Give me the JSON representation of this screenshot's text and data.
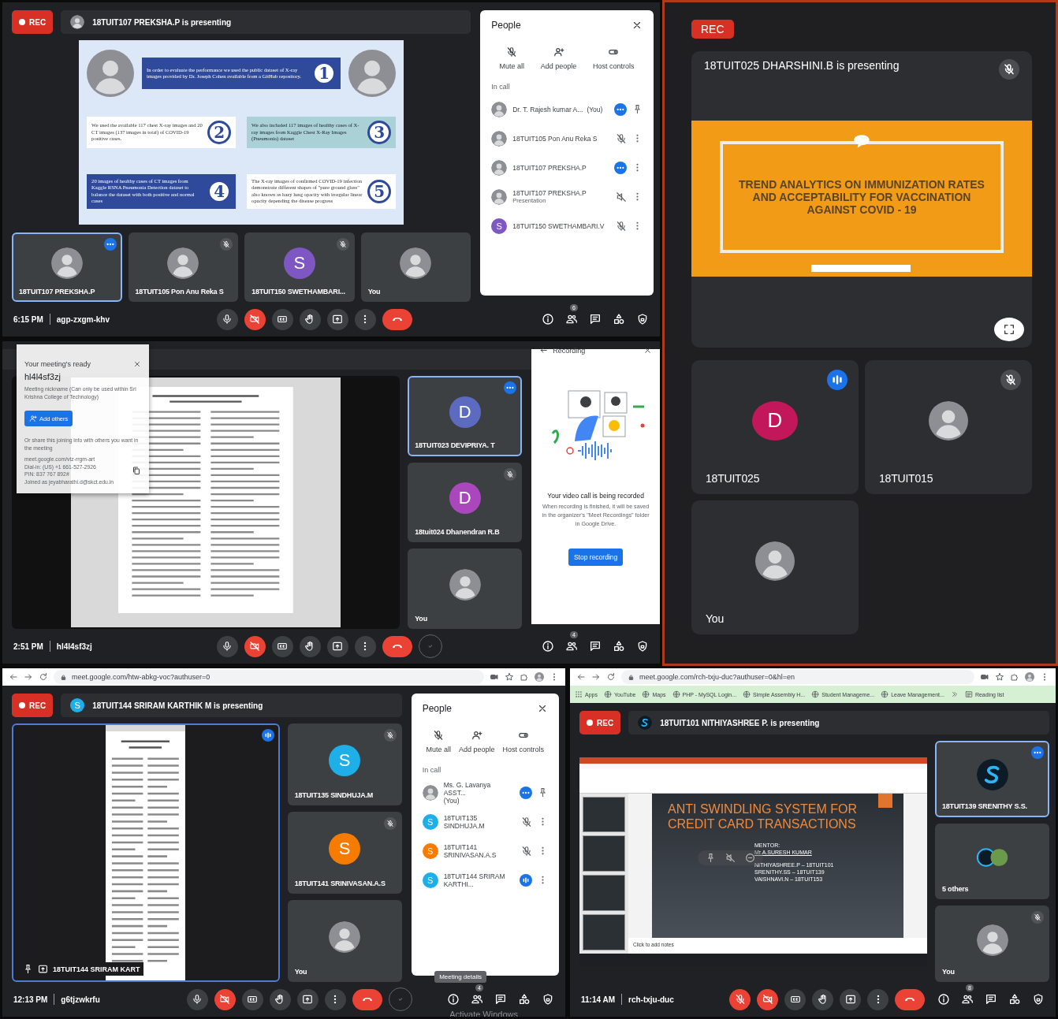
{
  "panels": [
    {
      "kind": "desktop",
      "rec": "REC",
      "presenting": {
        "text": "18TUIT107 PREKSHA.P is presenting",
        "avatar": {
          "kind": "photo"
        }
      },
      "stage": {
        "kind": "infographic",
        "items": [
          {
            "number": "1",
            "text": "In order to evaluate the performance we used the public dataset of X-ray images provided by Dr. Joseph Cohen available from a GitHub repository."
          },
          {
            "number": "2",
            "text": "We used the available 117 chest X-ray images and 20 CT images (137 images in total) of COVID-19 positive cases."
          },
          {
            "number": "3",
            "text": "We also included 117 images of healthy cases of X-ray images from Kaggle Chest X-Ray Images (Pneumonia) dataset"
          },
          {
            "number": "4",
            "text": "20 images of healthy cases of CT images from Kaggle RSNA Pneumonia Detection dataset to balance the dataset with both positive and normal cases"
          },
          {
            "number": "5",
            "text": "The X-ray images of confirmed COVID-19 infection demonstrate different shapes of \"pure ground glass\" also known as hazy lung opacity with irregular linear opacity depending the disease progress"
          }
        ]
      },
      "tile_strip": {
        "kind": "row",
        "tiles": [
          {
            "name": "18TUIT107 PREKSHA.P",
            "avatar": {
              "kind": "photo"
            },
            "badge": {
              "kind": "more"
            },
            "selected": true
          },
          {
            "name": "18TUIT105 Pon Anu Reka S",
            "avatar": {
              "kind": "photo"
            },
            "badge": {
              "kind": "muted"
            },
            "selected": false
          },
          {
            "name": "18TUIT150 SWETHAMBARI...",
            "avatar": {
              "kind": "letter",
              "letter": "S",
              "color": "#7e57c2"
            },
            "badge": {
              "kind": "muted"
            },
            "selected": false
          },
          {
            "name": "You",
            "avatar": {
              "kind": "photo"
            },
            "selected": false
          }
        ]
      },
      "side_panel": {
        "kind": "people",
        "title": "People",
        "actions": [
          {
            "kind": "mute",
            "label": "Mute all"
          },
          {
            "kind": "add",
            "label": "Add people"
          },
          {
            "kind": "host",
            "label": "Host controls"
          }
        ],
        "section": "In call",
        "people": [
          {
            "name": "Dr. T. Rajesh kumar A...",
            "you": "(You)",
            "avatar": {
              "kind": "photo"
            },
            "status": {
              "kind": "more"
            },
            "action": {
              "kind": "pin"
            }
          },
          {
            "name": "18TUIT105 Pon Anu Reka S",
            "avatar": {
              "kind": "photo"
            },
            "status": {
              "kind": "muted"
            },
            "action": {
              "kind": "menu"
            }
          },
          {
            "name": "18TUIT107 PREKSHA.P",
            "avatar": {
              "kind": "photo"
            },
            "status": {
              "kind": "more"
            },
            "action": {
              "kind": "menu"
            }
          },
          {
            "name": "18TUIT107 PREKSHA.P",
            "sub": "Presentation",
            "avatar": {
              "kind": "photo"
            },
            "status": {
              "kind": "volume_off"
            },
            "action": {
              "kind": "menu"
            }
          },
          {
            "name": "18TUIT150 SWETHAMBARI.V",
            "avatar": {
              "kind": "letter",
              "letter": "S",
              "color": "#7e57c2"
            },
            "status": {
              "kind": "muted"
            },
            "action": {
              "kind": "menu"
            }
          }
        ]
      },
      "footer": {
        "time": "6:15 PM",
        "code": "agp-zxgm-khv",
        "controls": [
          {
            "kind": "mic",
            "off": false
          },
          {
            "kind": "camera",
            "off": true
          },
          {
            "kind": "captions",
            "off": false
          },
          {
            "kind": "hand",
            "off": false
          },
          {
            "kind": "present",
            "off": false
          },
          {
            "kind": "more",
            "off": false
          },
          {
            "kind": "end",
            "off": false
          }
        ],
        "right": [
          {
            "kind": "info"
          },
          {
            "kind": "people",
            "count": "6"
          },
          {
            "kind": "chat"
          },
          {
            "kind": "activities"
          },
          {
            "kind": "safety"
          }
        ]
      }
    },
    {
      "kind": "mobile",
      "rec": "REC",
      "presenting": {
        "text": "18TUIT025 DHARSHINI.B is presenting",
        "badge": {
          "kind": "muted"
        }
      },
      "stage": {
        "kind": "slide",
        "title": "TREND ANALYTICS ON IMMUNIZATION RATES AND ACCEPTABILITY FOR VACCINATION AGAINST COVID - 19"
      },
      "tile_strip": {
        "kind": "grid",
        "tiles": [
          {
            "name": "18TUIT025",
            "avatar": {
              "kind": "letter",
              "letter": "D",
              "color": "#c2185b"
            },
            "badge": {
              "kind": "speaking"
            },
            "selected": false
          },
          {
            "name": "18TUIT015",
            "avatar": {
              "kind": "photo"
            },
            "badge": {
              "kind": "muted"
            },
            "selected": false
          },
          {
            "name": "You",
            "avatar": {
              "kind": "photo"
            },
            "selected": false
          }
        ]
      }
    },
    {
      "kind": "desktop",
      "popup": {
        "title": "Your meeting's ready",
        "code": "hl4l4sf3zj",
        "nickname": "Meeting nickname (Can only be used within Sri Krishna College of Technology)",
        "button": "Add others",
        "share": "Or share this joining info with others you want in the meeting",
        "link": "meet.google.com/vtz-rrgm-art",
        "dial": "Dial-in: (US) +1 661-527-2926",
        "pin": "PIN: 837 767 892#",
        "joined": "Joined as jeyabharathi.d@skct.edu.in"
      },
      "stage": {
        "kind": "document",
        "selected": false
      },
      "tile_strip": {
        "kind": "column",
        "tiles": [
          {
            "name": "18TUIT023 DEVIPRIYA. T",
            "avatar": {
              "kind": "letter",
              "letter": "D",
              "color": "#5c6bc0"
            },
            "badge": {
              "kind": "more"
            },
            "selected": true
          },
          {
            "name": "18tuit024 Dhanendran R.B",
            "avatar": {
              "kind": "letter",
              "letter": "D",
              "color": "#ab47bc"
            },
            "badge": {
              "kind": "muted"
            },
            "selected": false
          },
          {
            "name": "You",
            "avatar": {
              "kind": "photo"
            },
            "selected": false
          }
        ]
      },
      "side_panel": {
        "kind": "recording",
        "title": "Recording",
        "heading": "Your video call is being recorded",
        "text": "When recording is finished, it will be saved in the organizer's \"Meet Recordings\" folder in Google Drive.",
        "button": "Stop recording"
      },
      "footer": {
        "time": "2:51 PM",
        "code": "hl4l4sf3zj",
        "controls": [
          {
            "kind": "mic",
            "off": false
          },
          {
            "kind": "camera",
            "off": true
          },
          {
            "kind": "captions",
            "off": false
          },
          {
            "kind": "hand",
            "off": false
          },
          {
            "kind": "present",
            "off": false
          },
          {
            "kind": "more",
            "off": false
          },
          {
            "kind": "end",
            "off": false
          },
          {
            "kind": "check",
            "off": false
          }
        ],
        "right": [
          {
            "kind": "info"
          },
          {
            "kind": "people",
            "count": "4"
          },
          {
            "kind": "chat"
          },
          {
            "kind": "activities"
          },
          {
            "kind": "safety"
          }
        ]
      }
    },
    {
      "kind": "desktop",
      "browser": {
        "url": "meet.google.com/htw-abkg-voc?authuser=0"
      },
      "rec": "REC",
      "presenting": {
        "text": "18TUIT144 SRIRAM KARTHIK M is presenting",
        "avatar": {
          "kind": "letter",
          "letter": "S",
          "color": "#1eaee8"
        }
      },
      "stage": {
        "kind": "document",
        "selected": true,
        "label": "18TUIT144 SRIRAM KART",
        "badge": {
          "kind": "speaking"
        }
      },
      "tile_strip": {
        "kind": "column",
        "tiles": [
          {
            "name": "18TUIT135 SINDHUJA.M",
            "avatar": {
              "kind": "letter",
              "letter": "S",
              "color": "#1eaee8"
            },
            "badge": {
              "kind": "muted"
            },
            "selected": false
          },
          {
            "name": "18TUIT141 SRINIVASAN.A.S",
            "avatar": {
              "kind": "letter",
              "letter": "S",
              "color": "#f57c00"
            },
            "badge": {
              "kind": "muted"
            },
            "selected": false
          },
          {
            "name": "You",
            "avatar": {
              "kind": "photo"
            },
            "selected": false
          }
        ]
      },
      "side_panel": {
        "kind": "people",
        "title": "People",
        "actions": [
          {
            "kind": "mute",
            "label": "Mute all"
          },
          {
            "kind": "add",
            "label": "Add people"
          },
          {
            "kind": "host",
            "label": "Host controls"
          }
        ],
        "section": "In call",
        "people": [
          {
            "name": "Ms. G. Lavanya ASST...",
            "you": "(You)",
            "avatar": {
              "kind": "photo"
            },
            "status": {
              "kind": "more"
            },
            "action": {
              "kind": "pin"
            }
          },
          {
            "name": "18TUIT135 SINDHUJA.M",
            "avatar": {
              "kind": "letter",
              "letter": "S",
              "color": "#1eaee8"
            },
            "status": {
              "kind": "muted"
            },
            "action": {
              "kind": "menu"
            }
          },
          {
            "name": "18TUIT141 SRINIVASAN.A.S",
            "avatar": {
              "kind": "letter",
              "letter": "S",
              "color": "#f57c00"
            },
            "status": {
              "kind": "muted"
            },
            "action": {
              "kind": "menu"
            }
          },
          {
            "name": "18TUIT144 SRIRAM KARTHI...",
            "avatar": {
              "kind": "letter",
              "letter": "S",
              "color": "#1eaee8"
            },
            "status": {
              "kind": "speaking"
            },
            "action": {
              "kind": "menu"
            }
          }
        ]
      },
      "footer": {
        "time": "12:13 PM",
        "code": "g6tjzwkrfu",
        "tooltip": "Meeting details",
        "os_notice": "Activate Windows",
        "controls": [
          {
            "kind": "mic",
            "off": false
          },
          {
            "kind": "camera",
            "off": true
          },
          {
            "kind": "captions",
            "off": false
          },
          {
            "kind": "hand",
            "off": false
          },
          {
            "kind": "present",
            "off": false
          },
          {
            "kind": "more",
            "off": false
          },
          {
            "kind": "end",
            "off": false
          },
          {
            "kind": "check",
            "off": false
          }
        ],
        "right": [
          {
            "kind": "info"
          },
          {
            "kind": "people",
            "count": "4"
          },
          {
            "kind": "chat"
          },
          {
            "kind": "activities"
          },
          {
            "kind": "safety"
          }
        ]
      }
    },
    {
      "kind": "desktop",
      "browser": {
        "url": "meet.google.com/rch-txju-duc?authuser=0&hl=en",
        "bookmarks": [
          {
            "kind": "apps",
            "label": "Apps"
          },
          {
            "kind": "link",
            "label": "YouTube"
          },
          {
            "kind": "link",
            "label": "Maps"
          },
          {
            "kind": "link",
            "label": "PHP - MySQL Login..."
          },
          {
            "kind": "link",
            "label": "Simple Assembly H..."
          },
          {
            "kind": "link",
            "label": "Student Manageme..."
          },
          {
            "kind": "link",
            "label": "Leave Management..."
          },
          {
            "kind": "reading",
            "label": "Reading list"
          }
        ]
      },
      "rec": "REC",
      "presenting": {
        "text": "18TUIT101 NITHIYASHREE P. is presenting",
        "avatar": {
          "kind": "logo"
        }
      },
      "stage": {
        "kind": "presentation",
        "title": "ANTI SWINDLING SYSTEM FOR CREDIT CARD TRANSACTIONS",
        "mentor": [
          "MENTOR:",
          "Mr.A.SURESH KUMAR"
        ],
        "team": [
          "NITHIYASHREE.P – 18TUIT101",
          "SRENITHY.SS – 18TUIT139",
          "VAISHNAVI.N – 18TUIT153"
        ],
        "notes": "Click to add notes"
      },
      "tile_strip": {
        "kind": "column",
        "tiles": [
          {
            "name": "18TUIT139 SRENITHY S.S.",
            "avatar": {
              "kind": "logo"
            },
            "badge": {
              "kind": "more"
            },
            "selected": true
          },
          {
            "name": "5 others",
            "avatar": {
              "kind": "group"
            },
            "selected": false
          },
          {
            "name": "You",
            "avatar": {
              "kind": "photo"
            },
            "badge": {
              "kind": "muted"
            },
            "selected": false
          }
        ]
      },
      "footer": {
        "time": "11:14 AM",
        "code": "rch-txju-duc",
        "controls": [
          {
            "kind": "mic",
            "off": true
          },
          {
            "kind": "camera",
            "off": true
          },
          {
            "kind": "captions",
            "off": false
          },
          {
            "kind": "hand",
            "off": false
          },
          {
            "kind": "present",
            "off": false
          },
          {
            "kind": "more",
            "off": false
          },
          {
            "kind": "end",
            "off": false
          }
        ],
        "right": [
          {
            "kind": "info"
          },
          {
            "kind": "people",
            "count": "8"
          },
          {
            "kind": "chat"
          },
          {
            "kind": "activities"
          },
          {
            "kind": "safety"
          }
        ]
      }
    }
  ]
}
